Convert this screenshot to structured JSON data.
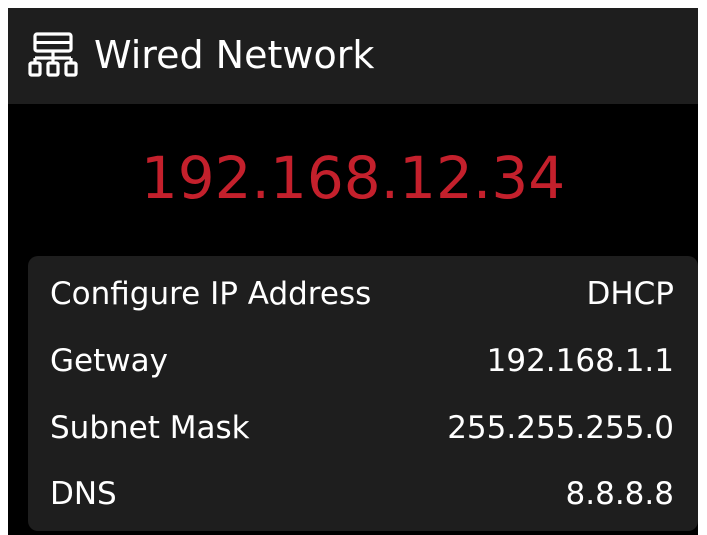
{
  "header": {
    "icon": "network-icon",
    "title": "Wired Network"
  },
  "ip_address": "192.168.12.34",
  "details": [
    {
      "label": "Configure IP Address",
      "value": "DHCP"
    },
    {
      "label": "Getway",
      "value": "192.168.1.1"
    },
    {
      "label": "Subnet Mask",
      "value": "255.255.255.0"
    },
    {
      "label": "DNS",
      "value": "8.8.8.8"
    }
  ],
  "colors": {
    "background": "#000000",
    "panel": "#1e1e1e",
    "ip_text": "#c4202c",
    "text": "#ffffff"
  }
}
